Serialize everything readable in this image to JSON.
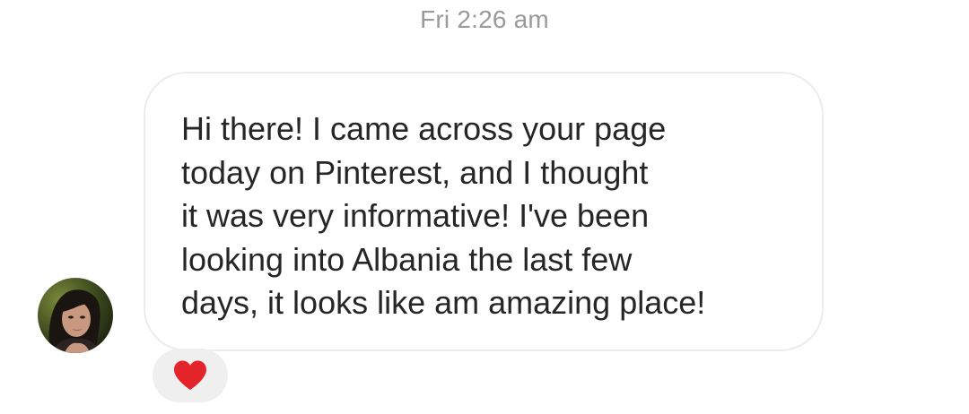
{
  "thread": {
    "timestamp": "Fri 2:26 am",
    "message": {
      "text": "Hi there! I came across your page\ntoday on Pinterest, and I thought\nit was very informative! I've been\nlooking into Albania the last few\ndays, it looks like am amazing place!",
      "reaction": {
        "icon": "heart-icon",
        "color": "#e3242b"
      }
    }
  },
  "colors": {
    "timestamp": "#9a9a9a",
    "text": "#262626",
    "bubble_border": "#ececec",
    "reaction_bg": "#efefef"
  }
}
